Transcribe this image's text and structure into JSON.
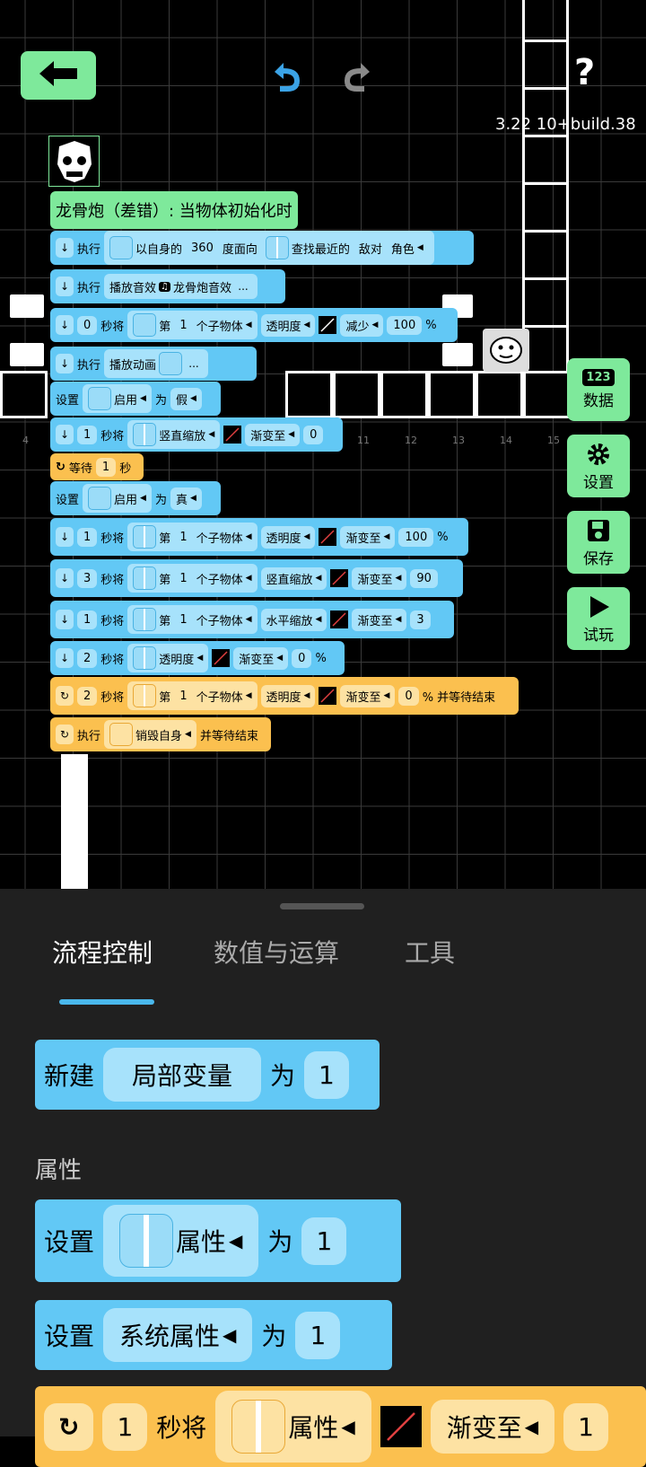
{
  "toolbar": {
    "back_icon": "arrow-left",
    "undo_icon": "undo",
    "redo_icon": "redo",
    "help": "?",
    "version": "3.22 10+build.38"
  },
  "side_buttons": [
    {
      "label": "数据",
      "icon_text": "123"
    },
    {
      "label": "设置",
      "icon": "gear"
    },
    {
      "label": "保存",
      "icon": "floppy"
    },
    {
      "label": "试玩",
      "icon": "play"
    }
  ],
  "grid_labels": [
    "4",
    "11",
    "12",
    "13",
    "14",
    "15"
  ],
  "colors": {
    "blue_block": "#62c8f5",
    "orange_block": "#fbc04f",
    "green_accent": "#7ee99b",
    "panel_bg": "#202020",
    "tab_indicator": "#4ab8ec"
  },
  "script": {
    "header": "龙骨炮（差错）: 当物体初始化时",
    "b1": {
      "a": "执行",
      "b": "以自身的",
      "c": "360",
      "d": "度面向",
      "e": "查找最近的",
      "f": "敌对",
      "g": "角色"
    },
    "b2": {
      "a": "执行",
      "b": "播放音效",
      "c": "龙骨炮音效",
      "d": "..."
    },
    "b3": {
      "a": "0",
      "b": "秒将",
      "c": "第",
      "d": "1",
      "e": "个子物体",
      "f": "透明度",
      "g": "减少",
      "h": "100",
      "i": "%"
    },
    "b4": {
      "a": "执行",
      "b": "播放动画",
      "c": "..."
    },
    "b5": {
      "a": "设置",
      "b": "启用",
      "c": "为",
      "d": "假"
    },
    "b6": {
      "a": "1",
      "b": "秒将",
      "c": "竖直缩放",
      "d": "渐变至",
      "e": "0"
    },
    "b7": {
      "a": "等待",
      "b": "1",
      "c": "秒"
    },
    "b8": {
      "a": "设置",
      "b": "启用",
      "c": "为",
      "d": "真"
    },
    "b9": {
      "a": "1",
      "b": "秒将",
      "c": "第",
      "d": "1",
      "e": "个子物体",
      "f": "透明度",
      "g": "渐变至",
      "h": "100",
      "i": "%"
    },
    "b10": {
      "a": "3",
      "b": "秒将",
      "c": "第",
      "d": "1",
      "e": "个子物体",
      "f": "竖直缩放",
      "g": "渐变至",
      "h": "90"
    },
    "b11": {
      "a": "1",
      "b": "秒将",
      "c": "第",
      "d": "1",
      "e": "个子物体",
      "f": "水平缩放",
      "g": "渐变至",
      "h": "3"
    },
    "b12": {
      "a": "2",
      "b": "秒将",
      "c": "透明度",
      "d": "渐变至",
      "e": "0",
      "f": "%"
    },
    "b13": {
      "a": "2",
      "b": "秒将",
      "c": "第",
      "d": "1",
      "e": "个子物体",
      "f": "透明度",
      "g": "渐变至",
      "h": "0",
      "i": "% 并等待结束"
    },
    "b14": {
      "a": "执行",
      "b": "销毁自身",
      "c": "并等待结束"
    }
  },
  "panel": {
    "tabs": [
      "流程控制",
      "数值与运算",
      "工具"
    ],
    "p1": {
      "a": "新建",
      "b": "局部变量",
      "c": "为",
      "d": "1"
    },
    "section": "属性",
    "p2": {
      "a": "设置",
      "b": "属性",
      "c": "为",
      "d": "1"
    },
    "p3": {
      "a": "设置",
      "b": "系统属性",
      "c": "为",
      "d": "1"
    },
    "p4": {
      "a": "1",
      "b": "秒将",
      "c": "属性",
      "d": "渐变至",
      "e": "1"
    }
  }
}
